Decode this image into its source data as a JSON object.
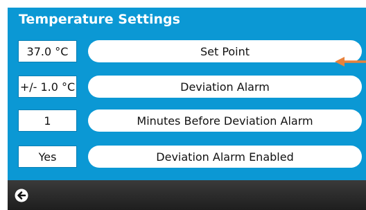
{
  "header": {
    "title": "Temperature Settings"
  },
  "settings": [
    {
      "value": "37.0 °C",
      "label": "Set Point"
    },
    {
      "value": "+/- 1.0 °C",
      "label": "Deviation Alarm"
    },
    {
      "value": "1",
      "label": "Minutes Before Deviation Alarm"
    },
    {
      "value": "Yes",
      "label": "Deviation Alarm Enabled"
    }
  ],
  "footer": {
    "back_icon": "back-arrow-icon"
  },
  "colors": {
    "screen_background": "#0b98d4",
    "footer_background": "#262626",
    "pointer_arrow": "#e8823c"
  }
}
